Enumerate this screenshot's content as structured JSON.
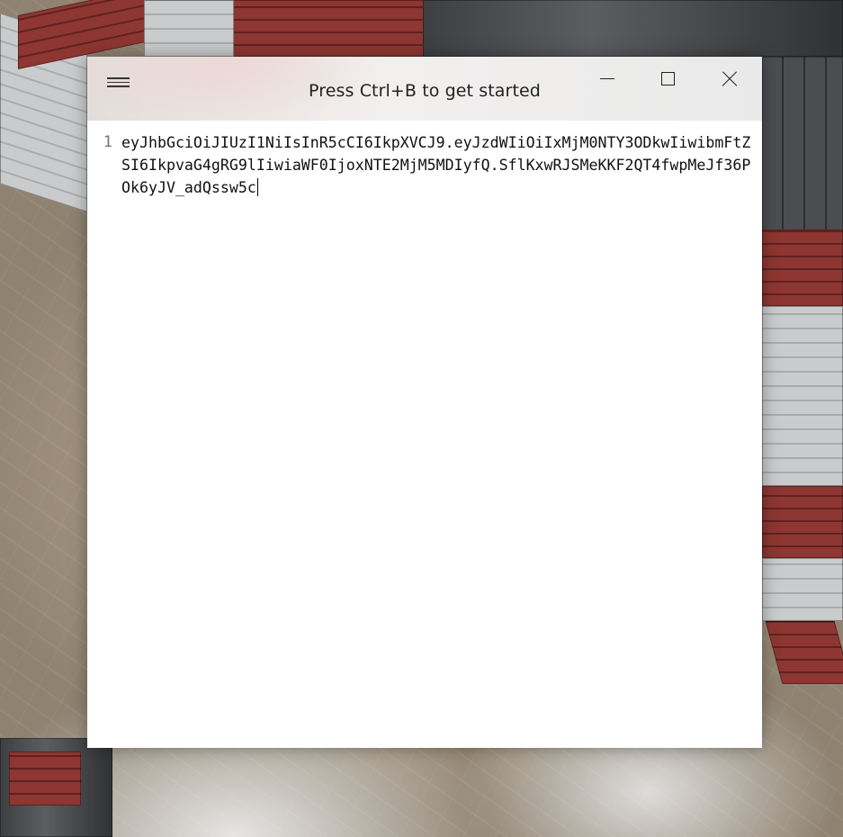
{
  "window": {
    "title": "Press Ctrl+B to get started",
    "menu_icon": "hamburger-icon",
    "minimize_icon": "minimize-icon",
    "maximize_icon": "maximize-icon",
    "close_icon": "close-icon"
  },
  "editor": {
    "line_numbers": [
      "1"
    ],
    "lines": [
      "eyJhbGciOiJIUzI1NiIsInR5cCI6IkpXVCJ9.eyJzdWIiOiIxMjM0NTY3ODkwIiwibmFtZSI6IkpvaG4gRG9lIiwiaWF0IjoxNTE2MjM5MDIyfQ.SflKxwRJSMeKKF2QT4fwpMeJf36POk6yJV_adQssw5c"
    ]
  },
  "colors": {
    "titlebar_tint": "#e4dcda",
    "editor_background": "#ffffff",
    "text": "#111111",
    "line_number": "#777777"
  }
}
